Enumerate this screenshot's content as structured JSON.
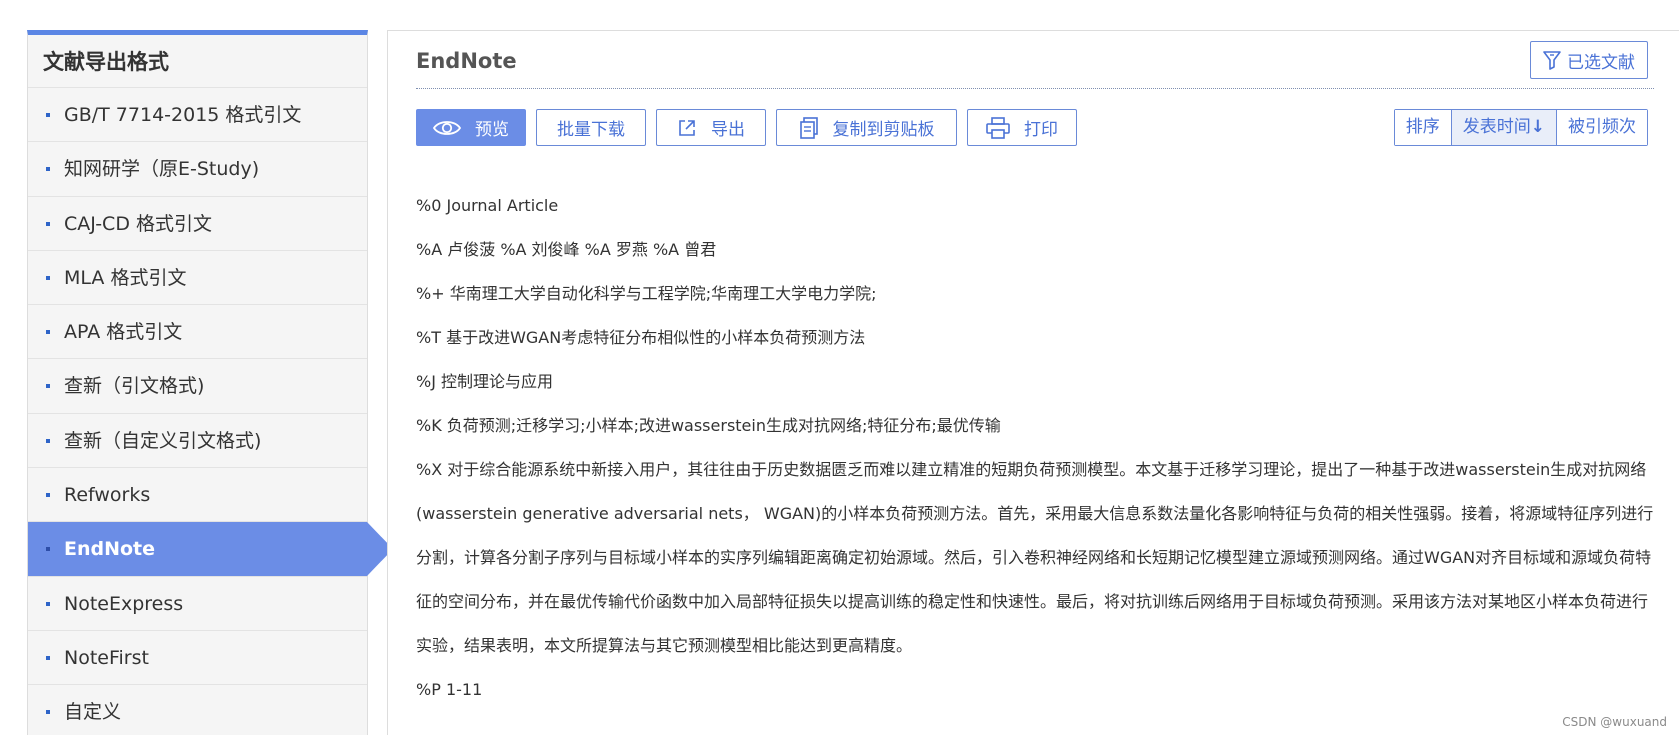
{
  "sidebar": {
    "title": "文献导出格式",
    "items": [
      {
        "label": "GB/T 7714-2015 格式引文"
      },
      {
        "label": "知网研学（原E-Study)"
      },
      {
        "label": "CAJ-CD 格式引文"
      },
      {
        "label": "MLA 格式引文"
      },
      {
        "label": "APA 格式引文"
      },
      {
        "label": "查新（引文格式)"
      },
      {
        "label": "查新（自定义引文格式)"
      },
      {
        "label": "Refworks"
      },
      {
        "label": "EndNote"
      },
      {
        "label": "NoteExpress"
      },
      {
        "label": "NoteFirst"
      },
      {
        "label": "自定义"
      }
    ],
    "active_index": 8
  },
  "main": {
    "title": "EndNote",
    "selected_button": "已选文献",
    "toolbar": {
      "preview": "预览",
      "batch_download": "批量下载",
      "export": "导出",
      "copy": "复制到剪贴板",
      "print": "打印"
    },
    "sort": {
      "label": "排序",
      "by_date": "发表时间",
      "by_citations": "被引频次"
    },
    "record": {
      "type": "%0 Journal Article",
      "authors": "%A 卢俊菠 %A 刘俊峰 %A 罗燕 %A 曾君",
      "affiliation": "%+ 华南理工大学自动化科学与工程学院;华南理工大学电力学院;",
      "title": "%T 基于改进WGAN考虑特征分布相似性的小样本负荷预测方法",
      "journal": "%J 控制理论与应用",
      "keywords": "%K 负荷预测;迁移学习;小样本;改进wasserstein生成对抗网络;特征分布;最优传输",
      "abstract": "%X 对于综合能源系统中新接入用户，其往往由于历史数据匮乏而难以建立精准的短期负荷预测模型。本文基于迁移学习理论，提出了一种基于改进wasserstein生成对抗网络(wasserstein generative adversarial nets， WGAN)的小样本负荷预测方法。首先，采用最大信息系数法量化各影响特征与负荷的相关性强弱。接着，将源域特征序列进行分割，计算各分割子序列与目标域小样本的实序列编辑距离确定初始源域。然后，引入卷积神经网络和长短期记忆模型建立源域预测网络。通过WGAN对齐目标域和源域负荷特征的空间分布，并在最优传输代价函数中加入局部特征损失以提高训练的稳定性和快速性。最后，将对抗训练后网络用于目标域负荷预测。采用该方法对某地区小样本负荷进行实验，结果表明，本文所提算法与其它预测模型相比能达到更高精度。",
      "pages": "%P 1-11"
    }
  },
  "watermark": "CSDN @wuxuand",
  "colors": {
    "accent": "#6b8de6",
    "border_blue": "#6a8ad8",
    "text_blue": "#4a72d6",
    "sidebar_bg": "#f5f5f5"
  }
}
